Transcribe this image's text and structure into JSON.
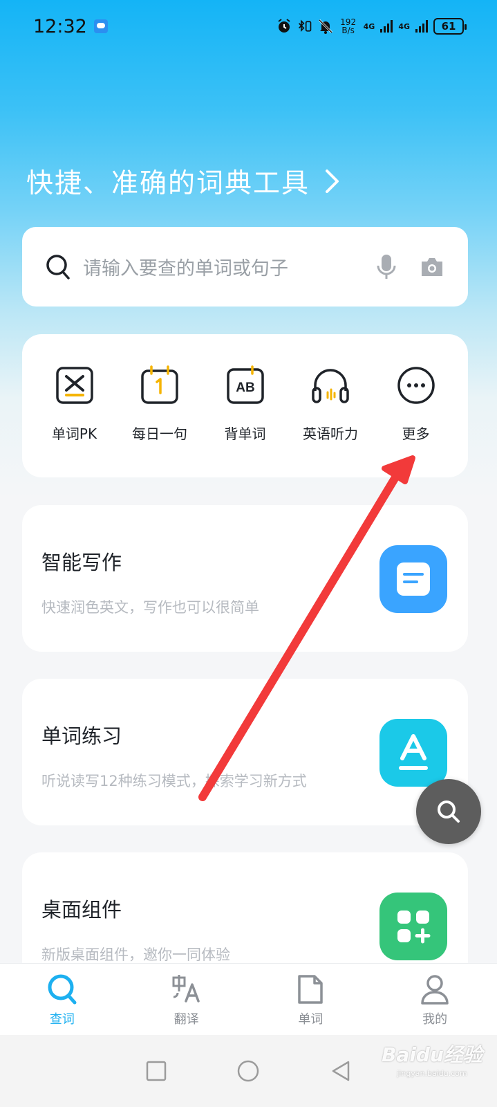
{
  "status_bar": {
    "time": "12:32",
    "speed_top": "192",
    "speed_unit": "B/s",
    "net_1": "4G",
    "net_2": "4G",
    "battery": "61"
  },
  "slogan": "快捷、准确的词典工具",
  "search": {
    "placeholder": "请输入要查的单词或句子"
  },
  "quick_actions": [
    {
      "label": "单词PK",
      "icon": "word-pk-icon"
    },
    {
      "label": "每日一句",
      "icon": "calendar-icon"
    },
    {
      "label": "背单词",
      "icon": "ab-card-icon"
    },
    {
      "label": "英语听力",
      "icon": "headphones-icon"
    },
    {
      "label": "更多",
      "icon": "more-icon"
    }
  ],
  "features": [
    {
      "title": "智能写作",
      "desc": "快速润色英文，写作也可以很简单",
      "color": "#3aa4ff",
      "icon": "document-icon"
    },
    {
      "title": "单词练习",
      "desc": "听说读写12种练习模式，探索学习新方式",
      "color": "#1bc9e8",
      "icon": "letter-a-icon"
    },
    {
      "title": "桌面组件",
      "desc": "新版桌面组件，邀你一同体验",
      "color": "#35c57a",
      "icon": "widgets-icon"
    }
  ],
  "tabs": [
    {
      "label": "查词",
      "icon": "search-icon",
      "active": true
    },
    {
      "label": "翻译",
      "icon": "translate-icon",
      "active": false
    },
    {
      "label": "单词",
      "icon": "file-icon",
      "active": false
    },
    {
      "label": "我的",
      "icon": "profile-icon",
      "active": false
    }
  ],
  "colors": {
    "accent": "#1db0f0",
    "annotation_arrow": "#f23a3a"
  },
  "watermark": {
    "main": "Baidu经验",
    "sub": "jingyan.baidu.com"
  }
}
